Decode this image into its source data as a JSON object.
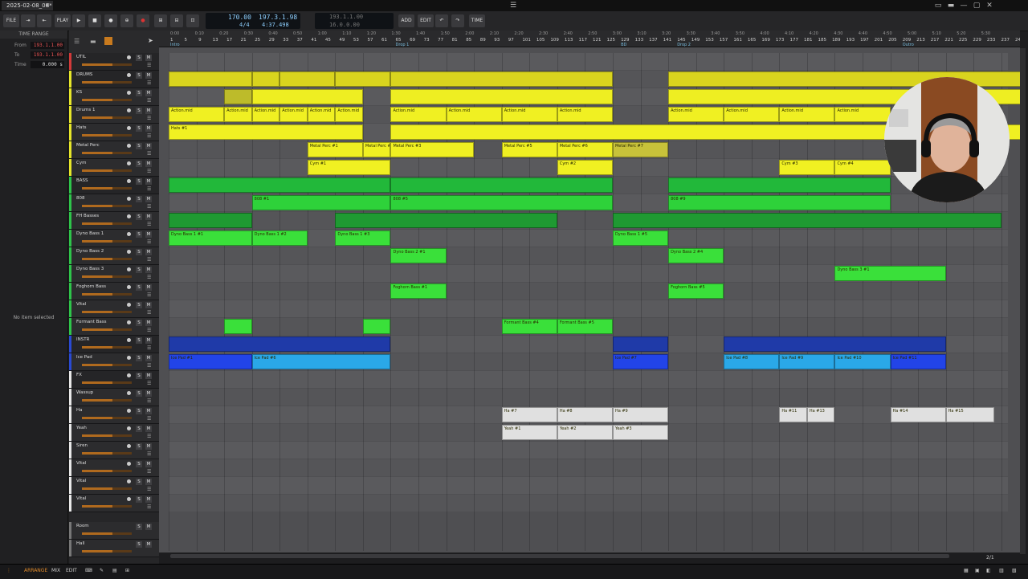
{
  "window": {
    "doc_tab": "2025-02-08_06*",
    "close_glyph": "✕",
    "menu_glyph": "☰",
    "win_controls": [
      "▭",
      "▬",
      "—",
      "▢",
      "✕"
    ]
  },
  "toolbar": {
    "file": "FILE",
    "play": "PLAY",
    "add": "ADD",
    "edit": "EDIT",
    "time": "TIME",
    "tempo": "170.00",
    "time_sig": "4/4",
    "position_beats": "197.3.1.98",
    "position_time": "4:37.498",
    "loop_start": "193.1.1.00",
    "loop_length": "16.0.0.00"
  },
  "time_range": {
    "title": "TIME RANGE",
    "from_label": "From",
    "from_value": "193.1.1.00",
    "to_label": "To",
    "to_value": "193.1.1.00",
    "time_label": "Time",
    "time_value": "0.000 s",
    "no_item": "No item selected"
  },
  "tracks": [
    {
      "name": "UTIL",
      "color": "#d23a3a",
      "fader": 0.62,
      "group": true
    },
    {
      "name": "DRUMS",
      "color": "#e6e62a",
      "fader": 0.62,
      "group": true
    },
    {
      "name": "KS",
      "color": "#e6e62a",
      "fader": 0.62
    },
    {
      "name": "Drums 1",
      "color": "#e6e62a",
      "fader": 0.62
    },
    {
      "name": "Hats",
      "color": "#e6e62a",
      "fader": 0.62
    },
    {
      "name": "Metal Perc",
      "color": "#e6e62a",
      "fader": 0.62
    },
    {
      "name": "Cym",
      "color": "#e6e62a",
      "fader": 0.62
    },
    {
      "name": "BASS",
      "color": "#2ec44a",
      "fader": 0.62,
      "group": true
    },
    {
      "name": "808",
      "color": "#2ec44a",
      "fader": 0.62
    },
    {
      "name": "FH Basses",
      "color": "#2ec44a",
      "fader": 0.62
    },
    {
      "name": "Dyno Bass 1",
      "color": "#2ec44a",
      "fader": 0.62
    },
    {
      "name": "Dyno Bass 2",
      "color": "#2ec44a",
      "fader": 0.62
    },
    {
      "name": "Dyno Bass 3",
      "color": "#2ec44a",
      "fader": 0.62
    },
    {
      "name": "Foghorn Bass",
      "color": "#2ec44a",
      "fader": 0.62
    },
    {
      "name": "Vital",
      "color": "#2ec44a",
      "fader": 0.62
    },
    {
      "name": "Formant Bass",
      "color": "#2ec44a",
      "fader": 0.62
    },
    {
      "name": "INSTR",
      "color": "#2a4ad2",
      "fader": 0.62,
      "group": true
    },
    {
      "name": "Ice Pad",
      "color": "#2a4ad2",
      "fader": 0.62
    },
    {
      "name": "FX",
      "color": "#e8e8e8",
      "fader": 0.62,
      "group": true
    },
    {
      "name": "Wassup",
      "color": "#e8e8e8",
      "fader": 0.62
    },
    {
      "name": "Ha",
      "color": "#e8e8e8",
      "fader": 0.62
    },
    {
      "name": "Yeah",
      "color": "#e8e8e8",
      "fader": 0.62
    },
    {
      "name": "Siren",
      "color": "#e8e8e8",
      "fader": 0.62
    },
    {
      "name": "Vital",
      "color": "#e8e8e8",
      "fader": 0.62
    },
    {
      "name": "Vital",
      "color": "#e8e8e8",
      "fader": 0.62
    },
    {
      "name": "Vital",
      "color": "#e8e8e8",
      "fader": 0.62
    }
  ],
  "fx_tracks": [
    {
      "name": "Room",
      "fader": 0.62
    },
    {
      "name": "Hall",
      "fader": 0.62
    }
  ],
  "track_buttons": {
    "solo": "S",
    "mute": "M"
  },
  "ruler": {
    "bars": [
      "1",
      "5",
      "9",
      "13",
      "17",
      "21",
      "25",
      "29",
      "33",
      "37",
      "41",
      "45",
      "49",
      "53",
      "57",
      "61",
      "65",
      "69",
      "73",
      "77",
      "81",
      "85",
      "89",
      "93",
      "97",
      "101",
      "105",
      "109",
      "113",
      "117",
      "121",
      "125",
      "129",
      "133",
      "137",
      "141",
      "145",
      "149",
      "153",
      "157",
      "161",
      "165",
      "169",
      "173",
      "177",
      "181",
      "185",
      "189",
      "193",
      "197",
      "201",
      "205",
      "209",
      "213",
      "217",
      "221",
      "225",
      "229",
      "233",
      "237",
      "241"
    ],
    "times": [
      "0:00",
      "0:10",
      "0:20",
      "0:30",
      "0:40",
      "0:50",
      "1:00",
      "1:10",
      "1:20",
      "1:30",
      "1:40",
      "1:50",
      "2:00",
      "2:10",
      "2:20",
      "2:30",
      "2:40",
      "2:50",
      "3:00",
      "3:10",
      "3:20",
      "3:30",
      "3:40",
      "3:50",
      "4:00",
      "4:10",
      "4:20",
      "4:30",
      "4:40",
      "4:50",
      "5:00",
      "5:10",
      "5:20",
      "5:30"
    ],
    "cues": [
      {
        "label": "Intro",
        "bar": 1
      },
      {
        "label": "Drop 1",
        "bar": 65
      },
      {
        "label": "BD",
        "bar": 129
      },
      {
        "label": "Drop 2",
        "bar": 145
      },
      {
        "label": "Outro",
        "bar": 209
      }
    ]
  },
  "clips": [
    {
      "lane": 1,
      "start": 1,
      "len": 24,
      "label": "",
      "color": "#d9d41e"
    },
    {
      "lane": 1,
      "start": 25,
      "len": 8,
      "label": "",
      "color": "#d9d41e"
    },
    {
      "lane": 1,
      "start": 33,
      "len": 16,
      "label": "",
      "color": "#d9d41e"
    },
    {
      "lane": 1,
      "start": 49,
      "len": 16,
      "label": "",
      "color": "#d9d41e"
    },
    {
      "lane": 1,
      "start": 65,
      "len": 64,
      "label": "",
      "color": "#d9d41e"
    },
    {
      "lane": 1,
      "start": 145,
      "len": 112,
      "label": "",
      "color": "#d9d41e"
    },
    {
      "lane": 2,
      "start": 17,
      "len": 8,
      "label": "",
      "color": "#bdbb2a"
    },
    {
      "lane": 2,
      "start": 25,
      "len": 32,
      "label": "",
      "color": "#eeee22"
    },
    {
      "lane": 2,
      "start": 65,
      "len": 64,
      "label": "",
      "color": "#eeee22"
    },
    {
      "lane": 2,
      "start": 145,
      "len": 112,
      "label": "",
      "color": "#eeee22"
    },
    {
      "lane": 3,
      "start": 1,
      "len": 16,
      "label": "Action.mid",
      "color": "#f0f022"
    },
    {
      "lane": 3,
      "start": 17,
      "len": 8,
      "label": "Action.mid",
      "color": "#f0f022"
    },
    {
      "lane": 3,
      "start": 25,
      "len": 8,
      "label": "Action.mid",
      "color": "#f0f022"
    },
    {
      "lane": 3,
      "start": 33,
      "len": 8,
      "label": "Action.mid",
      "color": "#f0f022"
    },
    {
      "lane": 3,
      "start": 41,
      "len": 8,
      "label": "Action.mid",
      "color": "#f0f022"
    },
    {
      "lane": 3,
      "start": 49,
      "len": 8,
      "label": "Action.mid",
      "color": "#f0f022"
    },
    {
      "lane": 3,
      "start": 65,
      "len": 16,
      "label": "Action.mid",
      "color": "#f0f022"
    },
    {
      "lane": 3,
      "start": 81,
      "len": 16,
      "label": "Action.mid",
      "color": "#f0f022"
    },
    {
      "lane": 3,
      "start": 97,
      "len": 16,
      "label": "Action.mid",
      "color": "#f0f022"
    },
    {
      "lane": 3,
      "start": 113,
      "len": 16,
      "label": "Action.mid",
      "color": "#f0f022"
    },
    {
      "lane": 3,
      "start": 145,
      "len": 16,
      "label": "Action.mid",
      "color": "#f0f022"
    },
    {
      "lane": 3,
      "start": 161,
      "len": 16,
      "label": "Action.mid",
      "color": "#f0f022"
    },
    {
      "lane": 3,
      "start": 177,
      "len": 16,
      "label": "Action.mid",
      "color": "#f0f022"
    },
    {
      "lane": 3,
      "start": 193,
      "len": 16,
      "label": "Action.mid",
      "color": "#f0f022"
    },
    {
      "lane": 4,
      "start": 1,
      "len": 56,
      "label": "Hats #1",
      "color": "#f0f022"
    },
    {
      "lane": 4,
      "start": 65,
      "len": 192,
      "label": "",
      "color": "#f0f022"
    },
    {
      "lane": 5,
      "start": 41,
      "len": 16,
      "label": "Metal Perc #1",
      "color": "#f0f022"
    },
    {
      "lane": 5,
      "start": 57,
      "len": 8,
      "label": "Metal Perc #2",
      "color": "#f0f022"
    },
    {
      "lane": 5,
      "start": 65,
      "len": 24,
      "label": "Metal Perc #3",
      "color": "#f0f022"
    },
    {
      "lane": 5,
      "start": 97,
      "len": 16,
      "label": "Metal Perc #5",
      "color": "#f0f022"
    },
    {
      "lane": 5,
      "start": 113,
      "len": 16,
      "label": "Metal Perc #6",
      "color": "#f0f022"
    },
    {
      "lane": 5,
      "start": 129,
      "len": 16,
      "label": "Metal Perc #7",
      "color": "#c8c23a"
    },
    {
      "lane": 6,
      "start": 41,
      "len": 24,
      "label": "Cym #1",
      "color": "#f0f022"
    },
    {
      "lane": 6,
      "start": 113,
      "len": 16,
      "label": "Cym #2",
      "color": "#f0f022"
    },
    {
      "lane": 6,
      "start": 177,
      "len": 16,
      "label": "Cym #3",
      "color": "#f0f022"
    },
    {
      "lane": 6,
      "start": 193,
      "len": 16,
      "label": "Cym #4",
      "color": "#f0f022"
    },
    {
      "lane": 7,
      "start": 1,
      "len": 64,
      "label": "",
      "color": "#22b83a"
    },
    {
      "lane": 7,
      "start": 65,
      "len": 64,
      "label": "",
      "color": "#22b83a"
    },
    {
      "lane": 7,
      "start": 145,
      "len": 64,
      "label": "",
      "color": "#22b83a"
    },
    {
      "lane": 8,
      "start": 25,
      "len": 40,
      "label": "808 #1",
      "color": "#2ed23a"
    },
    {
      "lane": 8,
      "start": 65,
      "len": 64,
      "label": "808 #5",
      "color": "#2ed23a"
    },
    {
      "lane": 8,
      "start": 145,
      "len": 64,
      "label": "808 #9",
      "color": "#2ed23a"
    },
    {
      "lane": 9,
      "start": 1,
      "len": 24,
      "label": "",
      "color": "#1f9a32"
    },
    {
      "lane": 9,
      "start": 49,
      "len": 64,
      "label": "",
      "color": "#1f9a32"
    },
    {
      "lane": 9,
      "start": 129,
      "len": 112,
      "label": "",
      "color": "#1f9a32"
    },
    {
      "lane": 10,
      "start": 1,
      "len": 24,
      "label": "Dyno Bass 1 #1",
      "color": "#3ae03a"
    },
    {
      "lane": 10,
      "start": 25,
      "len": 16,
      "label": "Dyno Bass 1 #2",
      "color": "#3ae03a"
    },
    {
      "lane": 10,
      "start": 49,
      "len": 16,
      "label": "Dyno Bass 1 #3",
      "color": "#3ae03a"
    },
    {
      "lane": 10,
      "start": 129,
      "len": 16,
      "label": "Dyno Bass 1 #5",
      "color": "#3ae03a"
    },
    {
      "lane": 11,
      "start": 65,
      "len": 16,
      "label": "Dyno Bass 2 #1",
      "color": "#3ae03a"
    },
    {
      "lane": 11,
      "start": 145,
      "len": 16,
      "label": "Dyno Bass 2 #4",
      "color": "#3ae03a"
    },
    {
      "lane": 12,
      "start": 193,
      "len": 32,
      "label": "Dyno Bass 3 #1",
      "color": "#3ae03a"
    },
    {
      "lane": 13,
      "start": 65,
      "len": 16,
      "label": "Foghorn Bass #1",
      "color": "#3ae03a"
    },
    {
      "lane": 13,
      "start": 145,
      "len": 16,
      "label": "Foghorn Bass #5",
      "color": "#3ae03a"
    },
    {
      "lane": 15,
      "start": 17,
      "len": 8,
      "label": "",
      "color": "#3ae03a"
    },
    {
      "lane": 15,
      "start": 57,
      "len": 8,
      "label": "",
      "color": "#3ae03a"
    },
    {
      "lane": 15,
      "start": 97,
      "len": 16,
      "label": "Formant Bass #4",
      "color": "#3ae03a"
    },
    {
      "lane": 15,
      "start": 113,
      "len": 16,
      "label": "Formant Bass #5",
      "color": "#3ae03a"
    },
    {
      "lane": 16,
      "start": 1,
      "len": 64,
      "label": "",
      "color": "#1f3aa8"
    },
    {
      "lane": 16,
      "start": 129,
      "len": 16,
      "label": "",
      "color": "#1f3aa8"
    },
    {
      "lane": 16,
      "start": 161,
      "len": 64,
      "label": "",
      "color": "#1f3aa8"
    },
    {
      "lane": 17,
      "start": 1,
      "len": 24,
      "label": "Ice Pad #1",
      "color": "#2244e8"
    },
    {
      "lane": 17,
      "start": 25,
      "len": 40,
      "label": "Ice Pad #6",
      "color": "#2aa8e8"
    },
    {
      "lane": 17,
      "start": 129,
      "len": 16,
      "label": "Ice Pad #7",
      "color": "#2244e8"
    },
    {
      "lane": 17,
      "start": 161,
      "len": 16,
      "label": "Ice Pad #8",
      "color": "#2aa8e8"
    },
    {
      "lane": 17,
      "start": 177,
      "len": 16,
      "label": "Ice Pad #9",
      "color": "#2aa8e8"
    },
    {
      "lane": 17,
      "start": 193,
      "len": 16,
      "label": "Ice Pad #10",
      "color": "#2aa8e8"
    },
    {
      "lane": 17,
      "start": 209,
      "len": 16,
      "label": "Ice Pad #11",
      "color": "#2244e8"
    },
    {
      "lane": 20,
      "start": 97,
      "len": 16,
      "label": "Ha #7",
      "color": "#e0e0e0"
    },
    {
      "lane": 20,
      "start": 113,
      "len": 16,
      "label": "Ha #8",
      "color": "#e0e0e0"
    },
    {
      "lane": 20,
      "start": 129,
      "len": 16,
      "label": "Ha #9",
      "color": "#e0e0e0"
    },
    {
      "lane": 20,
      "start": 177,
      "len": 8,
      "label": "Ha #11",
      "color": "#e0e0e0"
    },
    {
      "lane": 20,
      "start": 185,
      "len": 8,
      "label": "Ha #13",
      "color": "#e0e0e0"
    },
    {
      "lane": 20,
      "start": 209,
      "len": 16,
      "label": "Ha #14",
      "color": "#e0e0e0"
    },
    {
      "lane": 20,
      "start": 225,
      "len": 14,
      "label": "Ha #15",
      "color": "#e0e0e0"
    },
    {
      "lane": 21,
      "start": 97,
      "len": 16,
      "label": "Yeah #1",
      "color": "#e0e0e0"
    },
    {
      "lane": 21,
      "start": 113,
      "len": 16,
      "label": "Yeah #2",
      "color": "#e0e0e0"
    },
    {
      "lane": 21,
      "start": 129,
      "len": 16,
      "label": "Yeah #3",
      "color": "#e0e0e0"
    }
  ],
  "bottom": {
    "arrange": "ARRANGE",
    "mix": "MIX",
    "edit": "EDIT",
    "page": "2/1"
  }
}
